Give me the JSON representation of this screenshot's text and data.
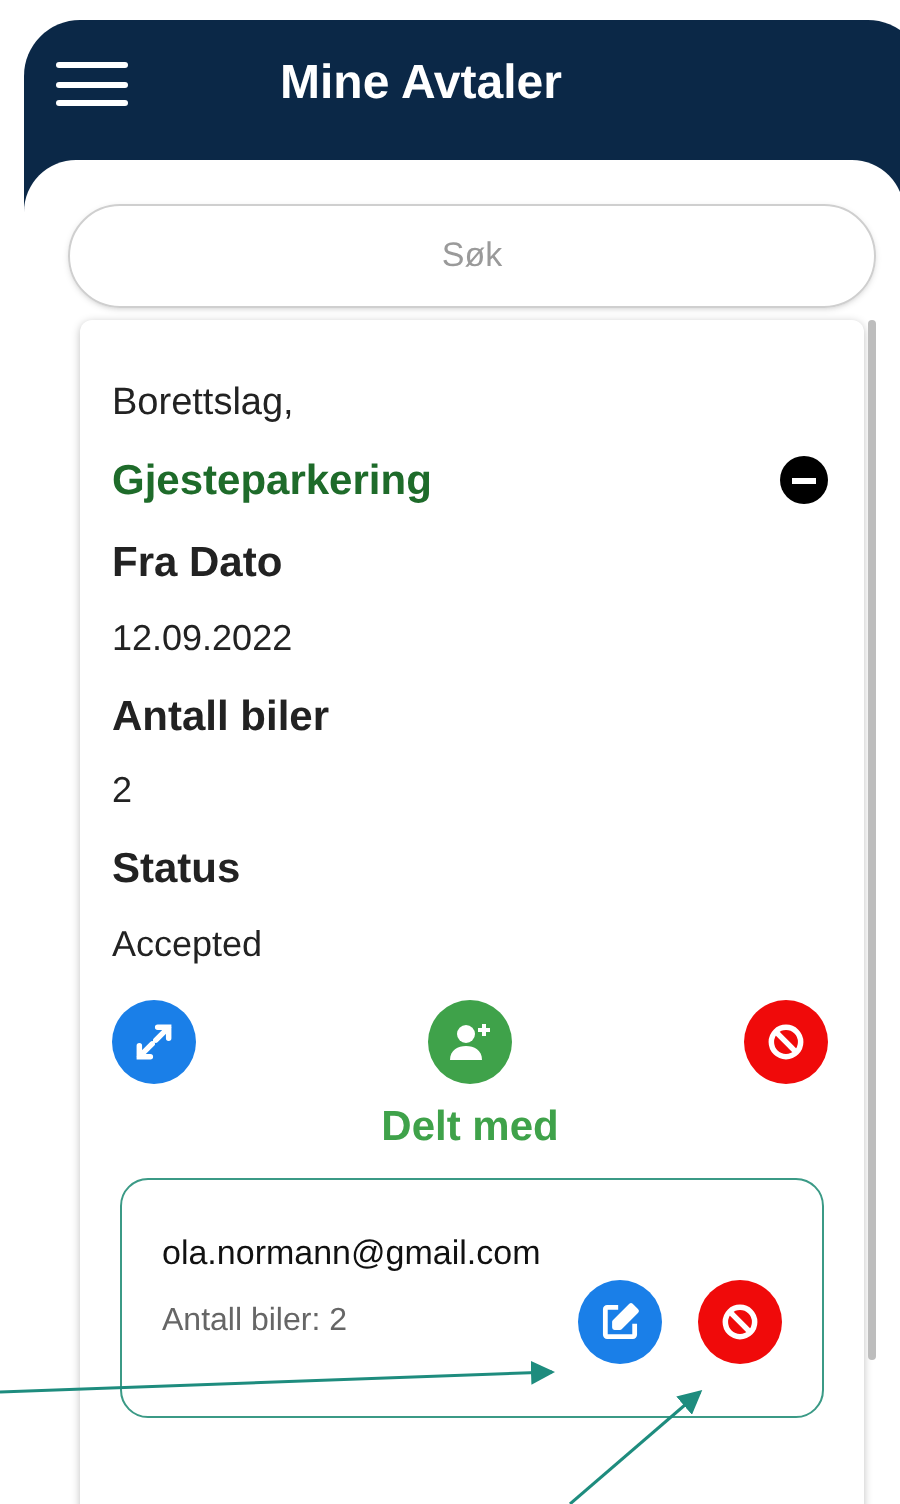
{
  "header": {
    "title": "Mine Avtaler"
  },
  "search": {
    "placeholder": "Søk"
  },
  "agreement": {
    "organization": "Borettslag,",
    "type": "Gjesteparkering",
    "fields": [
      {
        "label": "Fra Dato",
        "value": "12.09.2022"
      },
      {
        "label": "Antall biler",
        "value": "2"
      },
      {
        "label": "Status",
        "value": "Accepted"
      }
    ],
    "shared_heading": "Delt med",
    "shared_with": [
      {
        "email": "ola.normann@gmail.com",
        "cars": "Antall biler: 2"
      }
    ]
  }
}
